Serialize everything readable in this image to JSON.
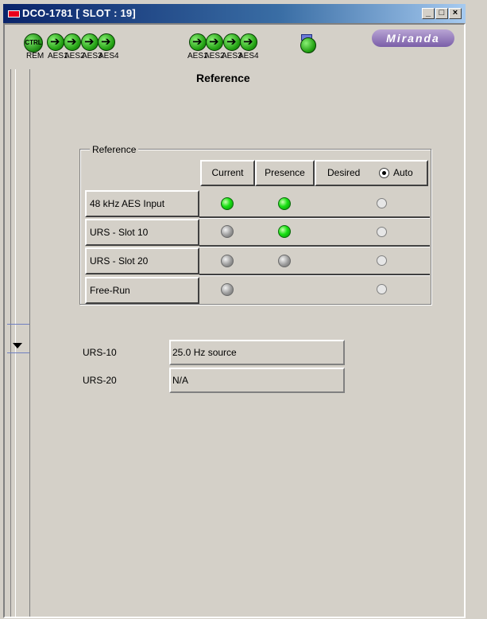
{
  "window": {
    "title": "DCO-1781 [ SLOT : 19]",
    "controls": {
      "minimize": "_",
      "maximize": "□",
      "close": "×"
    }
  },
  "toolbar": {
    "ctrl_text": "CTRL",
    "ctrl_label": "REM",
    "group1_labels": [
      "AES1",
      "AES2",
      "AES3",
      "AES4"
    ],
    "group2_labels": [
      "AES1",
      "AES2",
      "AES3",
      "AES4"
    ],
    "logo": "Miranda"
  },
  "panel": {
    "heading": "Reference",
    "group_title": "Reference",
    "columns": {
      "current": "Current",
      "presence": "Presence",
      "desired": "Desired",
      "auto": "Auto"
    },
    "auto_selected": true,
    "rows": [
      {
        "label": "48 kHz AES Input",
        "current": "green",
        "presence": "green",
        "desired_selected": false
      },
      {
        "label": "URS - Slot 10",
        "current": "gray",
        "presence": "green",
        "desired_selected": false
      },
      {
        "label": "URS - Slot 20",
        "current": "gray",
        "presence": "gray",
        "desired_selected": false
      },
      {
        "label": "Free-Run",
        "current": "gray",
        "presence": null,
        "desired_selected": false
      }
    ]
  },
  "info": {
    "urs10_label": "URS-10",
    "urs10_value": "25.0 Hz source",
    "urs20_label": "URS-20",
    "urs20_value": "N/A"
  },
  "colors": {
    "led_on": "#19e014",
    "led_off": "#9a9a9a",
    "background": "#d4d0c8",
    "titlebar": "#0a246a"
  }
}
